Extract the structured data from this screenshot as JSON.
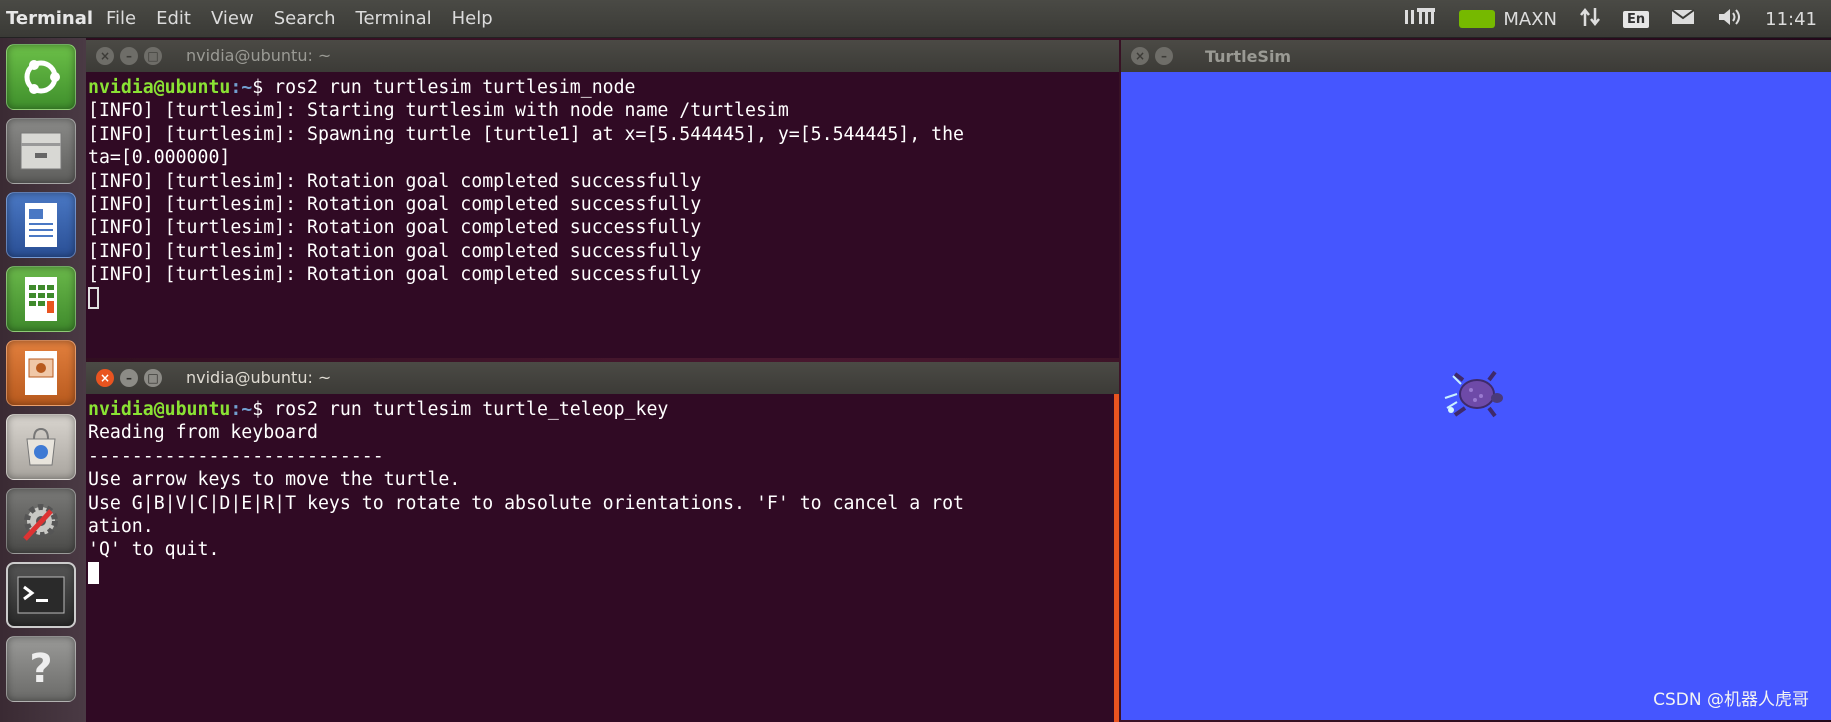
{
  "top_panel": {
    "app_name": "Terminal",
    "menu": [
      "File",
      "Edit",
      "View",
      "Search",
      "Terminal",
      "Help"
    ],
    "tray": {
      "power_mode": "MAXN",
      "keyboard": "En",
      "clock": "11:41"
    }
  },
  "launcher": {
    "items": [
      "ubuntu-dash",
      "files",
      "libreoffice-writer",
      "libreoffice-calc",
      "libreoffice-impress",
      "software-center",
      "system-settings",
      "terminal",
      "help"
    ]
  },
  "terminal1": {
    "title": "nvidia@ubuntu: ~",
    "prompt_user": "nvidia@ubuntu",
    "prompt_path": ":~",
    "command": "$ ros2 run turtlesim turtlesim_node",
    "lines": [
      "[INFO] [turtlesim]: Starting turtlesim with node name /turtlesim",
      "[INFO] [turtlesim]: Spawning turtle [turtle1] at x=[5.544445], y=[5.544445], the",
      "ta=[0.000000]",
      "[INFO] [turtlesim]: Rotation goal completed successfully",
      "[INFO] [turtlesim]: Rotation goal completed successfully",
      "[INFO] [turtlesim]: Rotation goal completed successfully",
      "[INFO] [turtlesim]: Rotation goal completed successfully",
      "[INFO] [turtlesim]: Rotation goal completed successfully"
    ]
  },
  "terminal2": {
    "title": "nvidia@ubuntu: ~",
    "prompt_user": "nvidia@ubuntu",
    "prompt_path": ":~",
    "command": "$ ros2 run turtlesim turtle_teleop_key",
    "lines": [
      "Reading from keyboard",
      "---------------------------",
      "Use arrow keys to move the turtle.",
      "Use G|B|V|C|D|E|R|T keys to rotate to absolute orientations. 'F' to cancel a rot",
      "ation.",
      "'Q' to quit."
    ]
  },
  "turtlesim": {
    "title": "TurtleSim",
    "background_color": "#4556ff"
  },
  "watermark": "CSDN @机器人虎哥"
}
